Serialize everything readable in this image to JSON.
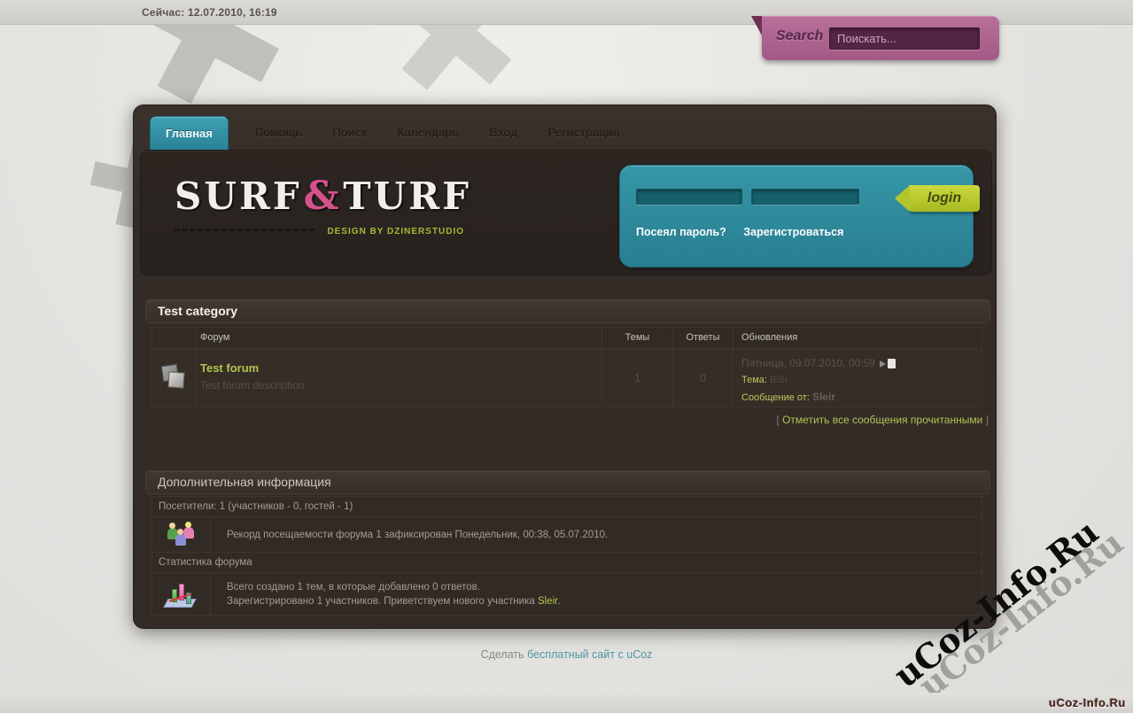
{
  "topbar": {
    "time": "Сейчас: 12.07.2010, 16:19"
  },
  "search": {
    "label": "Search",
    "placeholder": "Поискать...",
    "icon": "search-ribbon"
  },
  "nav": {
    "tabs": [
      {
        "label": "Главная",
        "active": true
      },
      {
        "label": "Помощь",
        "active": false
      },
      {
        "label": "Поиск",
        "active": false
      },
      {
        "label": "Календарь",
        "active": false
      },
      {
        "label": "Вход",
        "active": false
      },
      {
        "label": "Регистрация",
        "active": false
      }
    ]
  },
  "header": {
    "logo": {
      "part1": "SURF",
      "amp": "&",
      "part2": "TURF",
      "tagline": "DESIGN BY DZINERSTUDIO"
    },
    "login": {
      "button_label": "login",
      "lost_password": "Посеял пароль?",
      "register": "Зарегистроваться"
    }
  },
  "category": {
    "title": "Test category",
    "table": {
      "headers": {
        "forum": "Форум",
        "threads": "Темы",
        "replies": "Ответы",
        "updates": "Обновления"
      },
      "row": {
        "forum_name": "Test forum",
        "forum_desc": "Test forum description",
        "threads": "1",
        "replies": "0",
        "updated": "Пятница, 09.07.2010, 00:59",
        "topic_label": "Тема:",
        "topic": "BiBi",
        "from_label": "Сообщение от:",
        "from_user": "Sleir"
      },
      "icons": {
        "forum": "stacked-pages-icon",
        "goto_new": "goto-new-post-icon"
      }
    },
    "mark_read": {
      "open": "[",
      "label": "Отметить все сообщения прочитанными",
      "close": "]"
    }
  },
  "info": {
    "title": "Дополнительная информация",
    "visitors": "Посетители: 1  (участников - 0, гостей - 1)",
    "record": "Рекорд посещаемости форума 1 зафиксирован Понедельник, 00:38, 05.07.2010.",
    "stats_title": "Статистика форума",
    "stats_line1": "Всего создано 1 тем, в которые добавлено 0 ответов.",
    "stats_line2_prefix": "Зарегистрировано 1 участников. Приветствуем нового участника ",
    "stats_user": "Sleir",
    "stats_line2_suffix": ".",
    "icons": {
      "visitors": "people-group-icon",
      "stats": "bar-chart-icon"
    }
  },
  "footer": {
    "prefix": "Сделать ",
    "link": "бесплатный сайт с uCoz"
  },
  "watermark": {
    "big": "uCoz-Info.Ru",
    "small": "uCoz-Info.Ru"
  },
  "decor": {
    "cross_glyph": "✚"
  },
  "colors": {
    "accent_teal": "#2f8fa0",
    "accent_pink": "#ad5f88",
    "accent_green": "#b5c72c",
    "link_green": "#b2c354",
    "footer_link": "#4e96a6",
    "container_bg": "#332b26",
    "page_bg": "#e4e3e0"
  }
}
